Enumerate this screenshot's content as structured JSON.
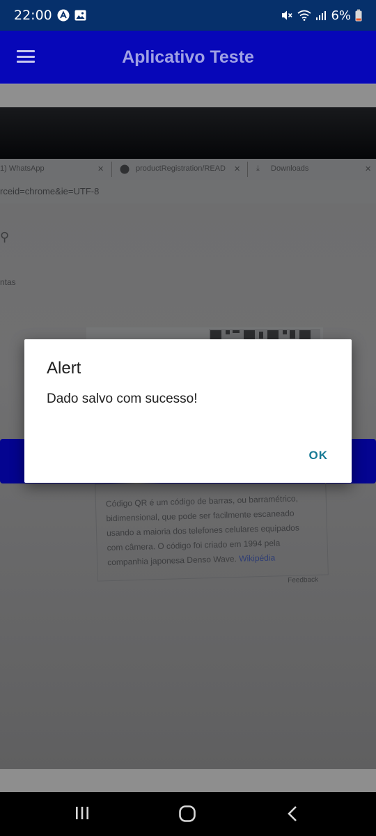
{
  "status_bar": {
    "time": "22:00",
    "battery": "6%",
    "left_icons": [
      "app-a-icon",
      "image-icon"
    ],
    "right_icons": [
      "mute-icon",
      "wifi-icon",
      "signal-icon",
      "battery-icon"
    ]
  },
  "app_bar": {
    "title": "Aplicativo Teste",
    "menu_icon": "hamburger-menu-icon",
    "color": "#0707b8"
  },
  "camera_view": {
    "tabs": [
      "1) WhatsApp",
      "productRegistration/READ",
      "Downloads"
    ],
    "url_fragment": "rceid=chrome&ie=UTF-8",
    "side_text": "ntas",
    "card_lines": [
      "Código QR é um código de barras, ou barramétrico,",
      "bidimensional, que pode ser facilmente escaneado",
      "usando a maioria dos telefones celulares equipados",
      "com câmera. O código foi criado em 1994 pela",
      "companhia japonesa Denso Wave."
    ],
    "card_link": "Wikipédia",
    "card_feedback": "Feedback"
  },
  "dialog": {
    "title": "Alert",
    "message": "Dado salvo com sucesso!",
    "ok_label": "OK",
    "accent_color": "#177a95"
  },
  "nav_bar": {
    "buttons": [
      "recent-apps-icon",
      "home-icon",
      "back-icon"
    ]
  }
}
